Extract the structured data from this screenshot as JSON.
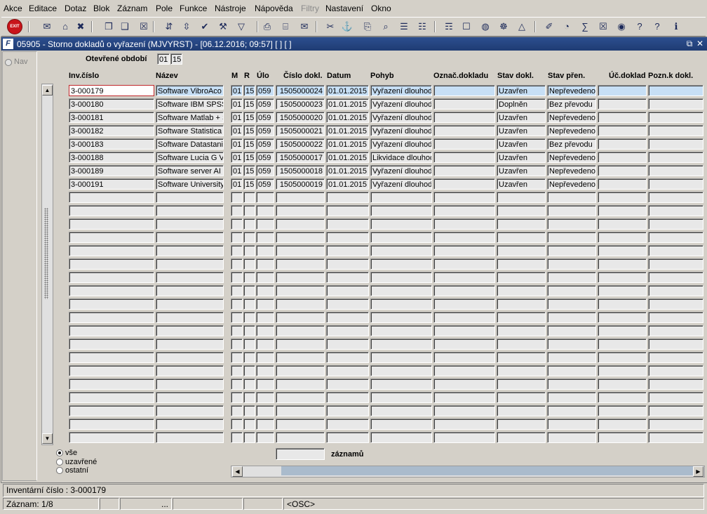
{
  "menu": {
    "items": [
      "Akce",
      "Editace",
      "Dotaz",
      "Blok",
      "Záznam",
      "Pole",
      "Funkce",
      "Nástroje",
      "Nápověda",
      "Filtry",
      "Nastavení",
      "Okno"
    ]
  },
  "toolbar": {
    "exit_label": "EXIT"
  },
  "window": {
    "title": "05905 - Storno dokladů o vyřazení (MJVYRST) - [06.12.2016; 09:57] [ ] [ ]",
    "logo": "F"
  },
  "nav": {
    "label": "Nav"
  },
  "period": {
    "label": "Otevřené období",
    "month": "01",
    "year": "15"
  },
  "columns": [
    "Inv.číslo",
    "Název",
    "M",
    "R",
    "Úlo",
    "Číslo dokl.",
    "Datum",
    "Pohyb",
    "Označ.dokladu",
    "Stav dokl.",
    "Stav přen.",
    "Úč.doklad",
    "Pozn.k dokl."
  ],
  "rows": [
    [
      "3-000179",
      "Software VibroAco",
      "01",
      "15",
      "059",
      "1505000024",
      "01.01.2015",
      "Vyřazení dlouhod",
      "",
      "Uzavřen",
      "Nepřevedeno",
      "",
      ""
    ],
    [
      "3-000180",
      "Software IBM SPSS",
      "01",
      "15",
      "059",
      "1505000023",
      "01.01.2015",
      "Vyřazení dlouhod",
      "",
      "Doplněn",
      "Bez převodu",
      "",
      ""
    ],
    [
      "3-000181",
      "Software Matlab + S",
      "01",
      "15",
      "059",
      "1505000020",
      "01.01.2015",
      "Vyřazení dlouhod",
      "",
      "Uzavřen",
      "Nepřevedeno",
      "",
      ""
    ],
    [
      "3-000182",
      "Software Statistica",
      "01",
      "15",
      "059",
      "1505000021",
      "01.01.2015",
      "Vyřazení dlouhod",
      "",
      "Uzavřen",
      "Nepřevedeno",
      "",
      ""
    ],
    [
      "3-000183",
      "Software Datastani",
      "01",
      "15",
      "059",
      "1505000022",
      "01.01.2015",
      "Vyřazení dlouhod",
      "",
      "Uzavřen",
      "Bez převodu",
      "",
      ""
    ],
    [
      "3-000188",
      "Software Lucia G V",
      "01",
      "15",
      "059",
      "1505000017",
      "01.01.2015",
      "Likvidace dlouhod",
      "",
      "Uzavřen",
      "Nepřevedeno",
      "",
      ""
    ],
    [
      "3-000189",
      "Software server AI",
      "01",
      "15",
      "059",
      "1505000018",
      "01.01.2015",
      "Vyřazení dlouhod",
      "",
      "Uzavřen",
      "Nepřevedeno",
      "",
      ""
    ],
    [
      "3-000191",
      "Software University",
      "01",
      "15",
      "059",
      "1505000019",
      "01.01.2015",
      "Vyřazení dlouhod",
      "",
      "Uzavřen",
      "Nepřevedeno",
      "",
      ""
    ]
  ],
  "filter": {
    "options": [
      "vše",
      "uzavřené",
      "ostatní"
    ],
    "selected": 0
  },
  "records": {
    "count": "",
    "label": "záznamů"
  },
  "status": {
    "line1": "Inventární číslo : 3-000179",
    "record": "Záznam: 1/8",
    "dots": "...",
    "osc": "<OSC>"
  }
}
